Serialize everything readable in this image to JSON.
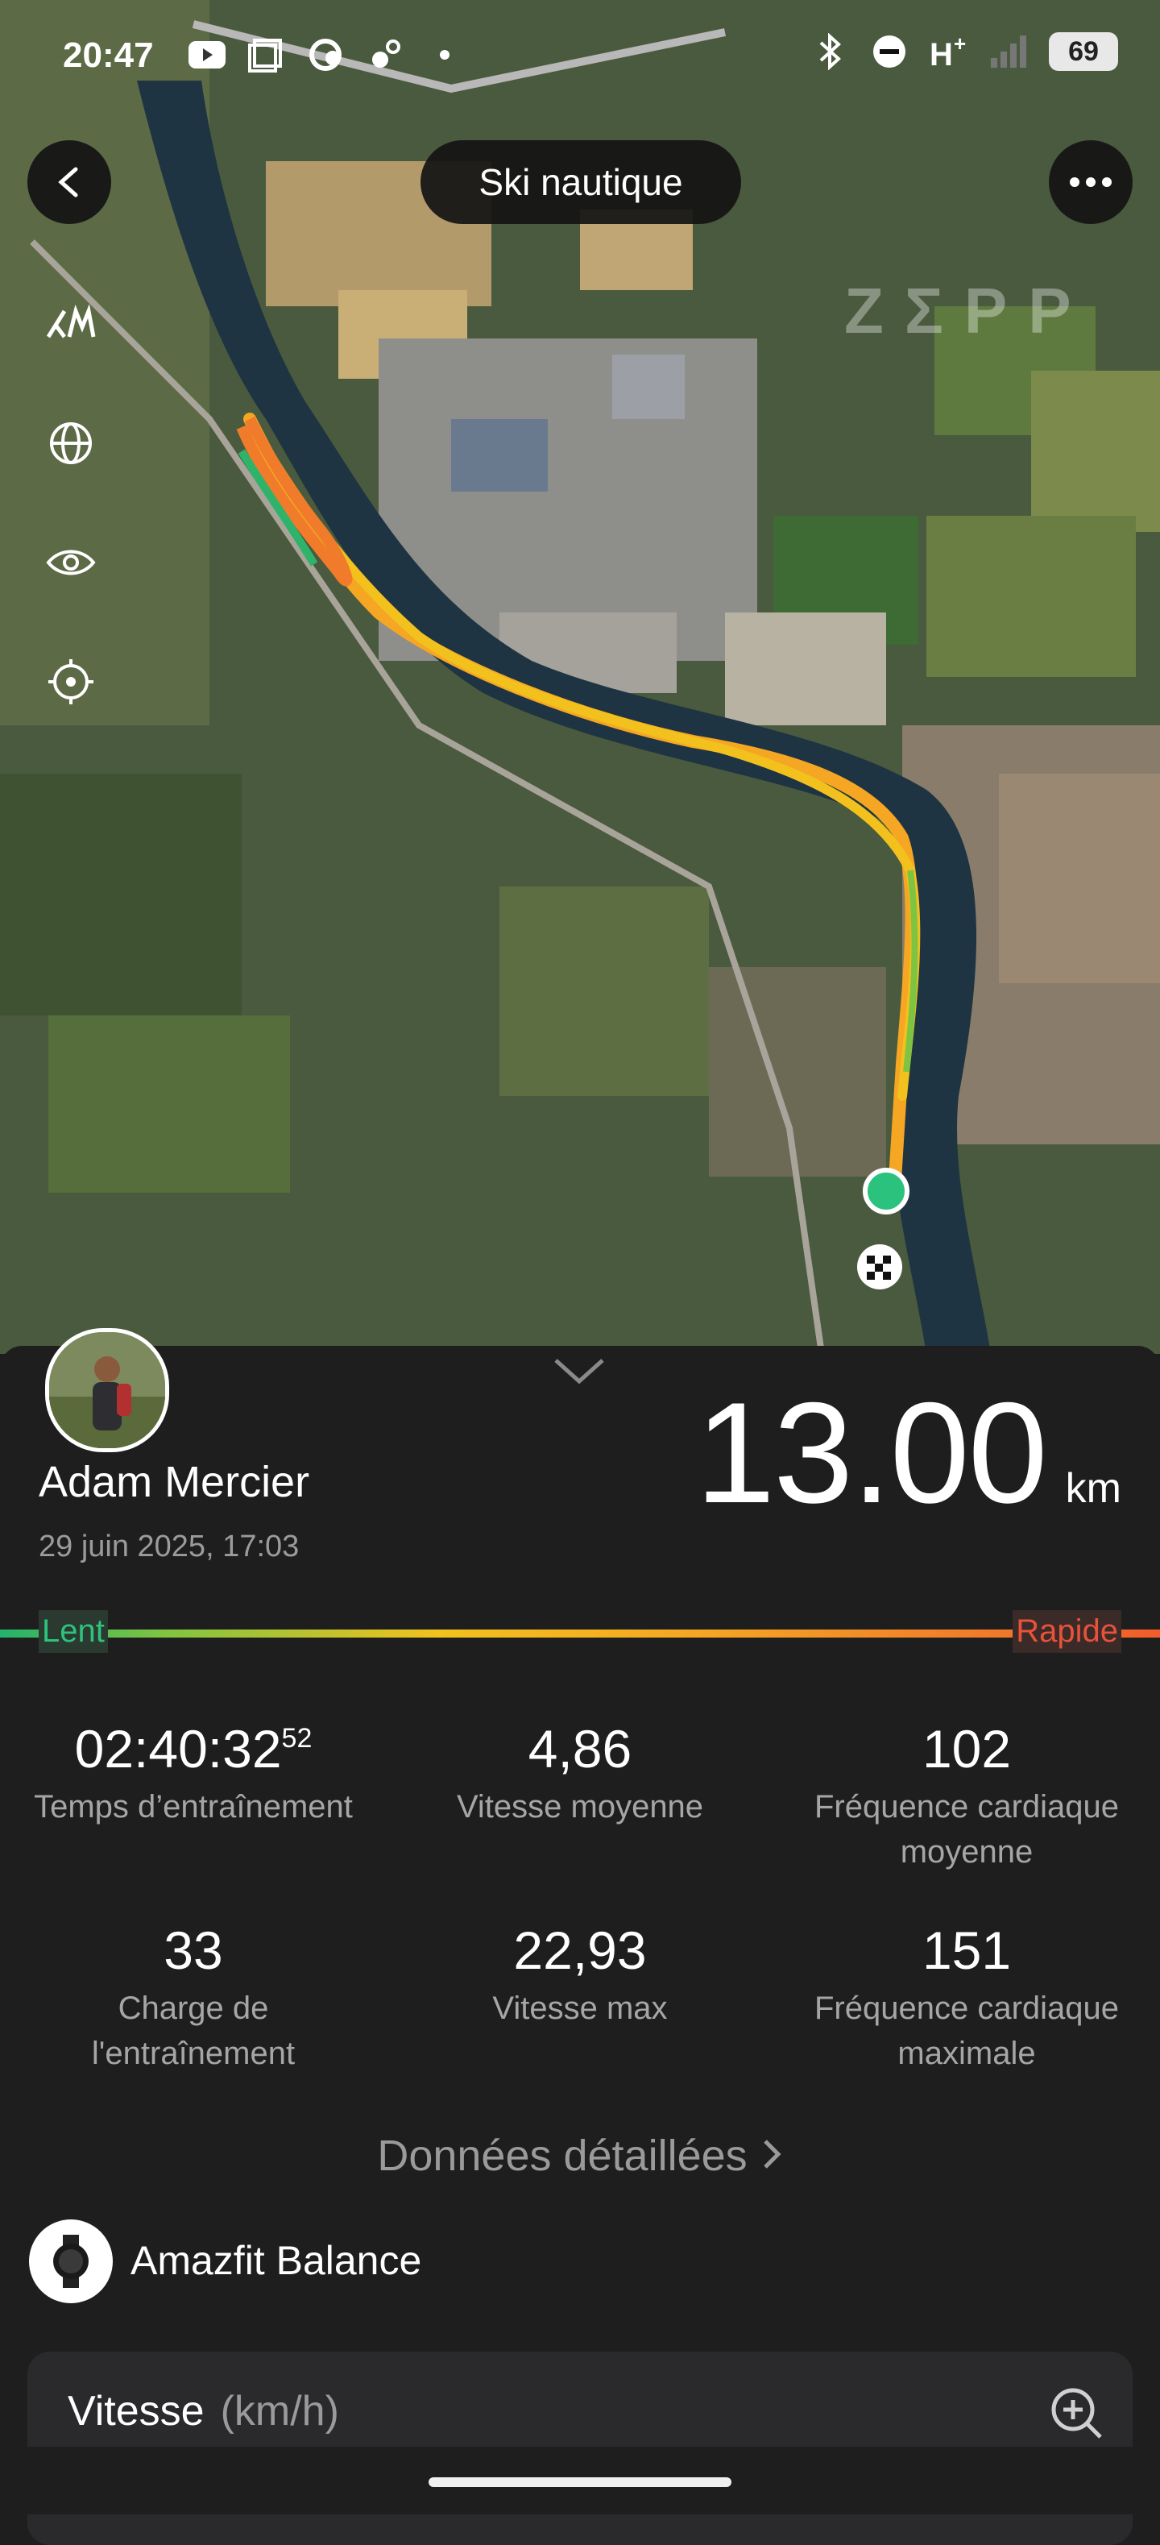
{
  "status_bar": {
    "time": "20:47",
    "battery": "69",
    "icons_left": [
      "youtube-icon",
      "screen-icon",
      "sync-icon",
      "cloud-settings-icon",
      "dot-icon"
    ],
    "icons_right": [
      "bluetooth-icon",
      "dnd-icon",
      "network-h-plus-icon",
      "signal-icon"
    ]
  },
  "header": {
    "title": "Ski nautique"
  },
  "map": {
    "watermark": "ZΣPP",
    "track_colors": [
      "#2fb36b",
      "#f2c11e",
      "#f5a623",
      "#f07b2a"
    ]
  },
  "user": {
    "name": "Adam Mercier",
    "date": "29 juin 2025, 17:03"
  },
  "distance": {
    "value": "13.00",
    "unit": "km"
  },
  "speed_scale": {
    "slow": "Lent",
    "fast": "Rapide"
  },
  "metrics": [
    {
      "value": "02:40:32",
      "sup": "52",
      "label": "Temps d’entraînement"
    },
    {
      "value": "4,86",
      "label": "Vitesse moyenne"
    },
    {
      "value": "102",
      "label": "Fréquence cardiaque moyenne"
    },
    {
      "value": "33",
      "label": "Charge de l'entraînement"
    },
    {
      "value": "22,93",
      "label": "Vitesse max"
    },
    {
      "value": "151",
      "label": "Fréquence cardiaque maximale"
    }
  ],
  "detail_link": "Données détaillées",
  "device": {
    "name": "Amazfit Balance"
  },
  "speed_chart": {
    "title": "Vitesse",
    "unit": "(km/h)"
  }
}
